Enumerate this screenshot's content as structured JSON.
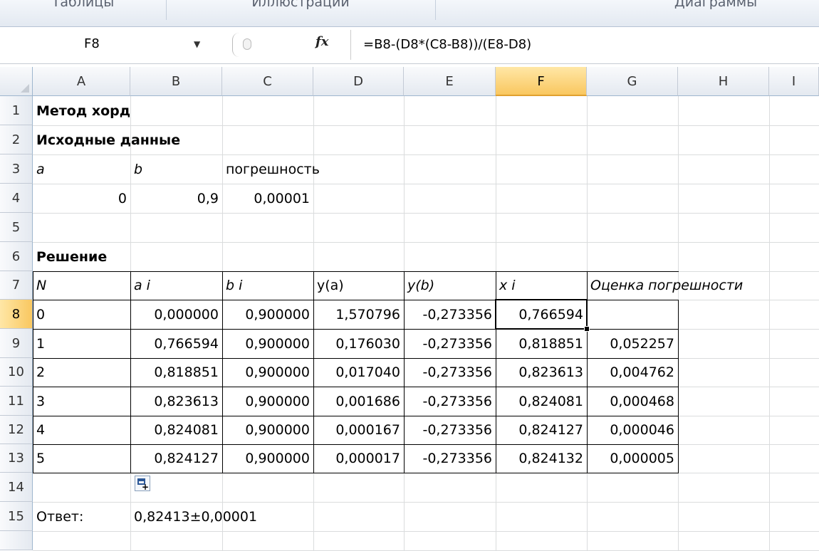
{
  "ribbon": {
    "groups": [
      "Таблицы",
      "Иллюстрации",
      "",
      "Диаграммы"
    ]
  },
  "formula_bar": {
    "name_box": "F8",
    "fx_icon": "fx",
    "formula": "=B8-(D8*(C8-B8))/(E8-D8)"
  },
  "columns": [
    "A",
    "B",
    "C",
    "D",
    "E",
    "F",
    "G",
    "H",
    "I"
  ],
  "selected_column": "F",
  "rows": [
    "1",
    "2",
    "3",
    "4",
    "5",
    "6",
    "7",
    "8",
    "9",
    "10",
    "11",
    "12",
    "13",
    "14",
    "15"
  ],
  "selected_row": "8",
  "sheet": {
    "title": "Метод хорд",
    "input_heading": "Исходные  данные",
    "input_labels": {
      "a": "a",
      "b": "b",
      "tol": "погрешность"
    },
    "input_values": {
      "a": "0",
      "b": "0,9",
      "tol": "0,00001"
    },
    "solution_heading": "Решение",
    "table_headers": [
      "N",
      "a i",
      "b i",
      "y(a)",
      "y(b)",
      "x i",
      "Оценка погрешности"
    ],
    "table_rows": [
      [
        "0",
        "0,000000",
        "0,900000",
        "1,570796",
        "-0,273356",
        "0,766594",
        ""
      ],
      [
        "1",
        "0,766594",
        "0,900000",
        "0,176030",
        "-0,273356",
        "0,818851",
        "0,052257"
      ],
      [
        "2",
        "0,818851",
        "0,900000",
        "0,017040",
        "-0,273356",
        "0,823613",
        "0,004762"
      ],
      [
        "3",
        "0,823613",
        "0,900000",
        "0,001686",
        "-0,273356",
        "0,824081",
        "0,000468"
      ],
      [
        "4",
        "0,824081",
        "0,900000",
        "0,000167",
        "-0,273356",
        "0,824127",
        "0,000046"
      ],
      [
        "5",
        "0,824127",
        "0,900000",
        "0,000017",
        "-0,273356",
        "0,824132",
        "0,000005"
      ]
    ],
    "answer_label": "Ответ:",
    "answer_value": "0,82413±0,00001"
  },
  "icons": {
    "paste_options": "paste-options-icon",
    "name_box_dropdown": "chevron-down-icon",
    "fx": "function-icon"
  }
}
